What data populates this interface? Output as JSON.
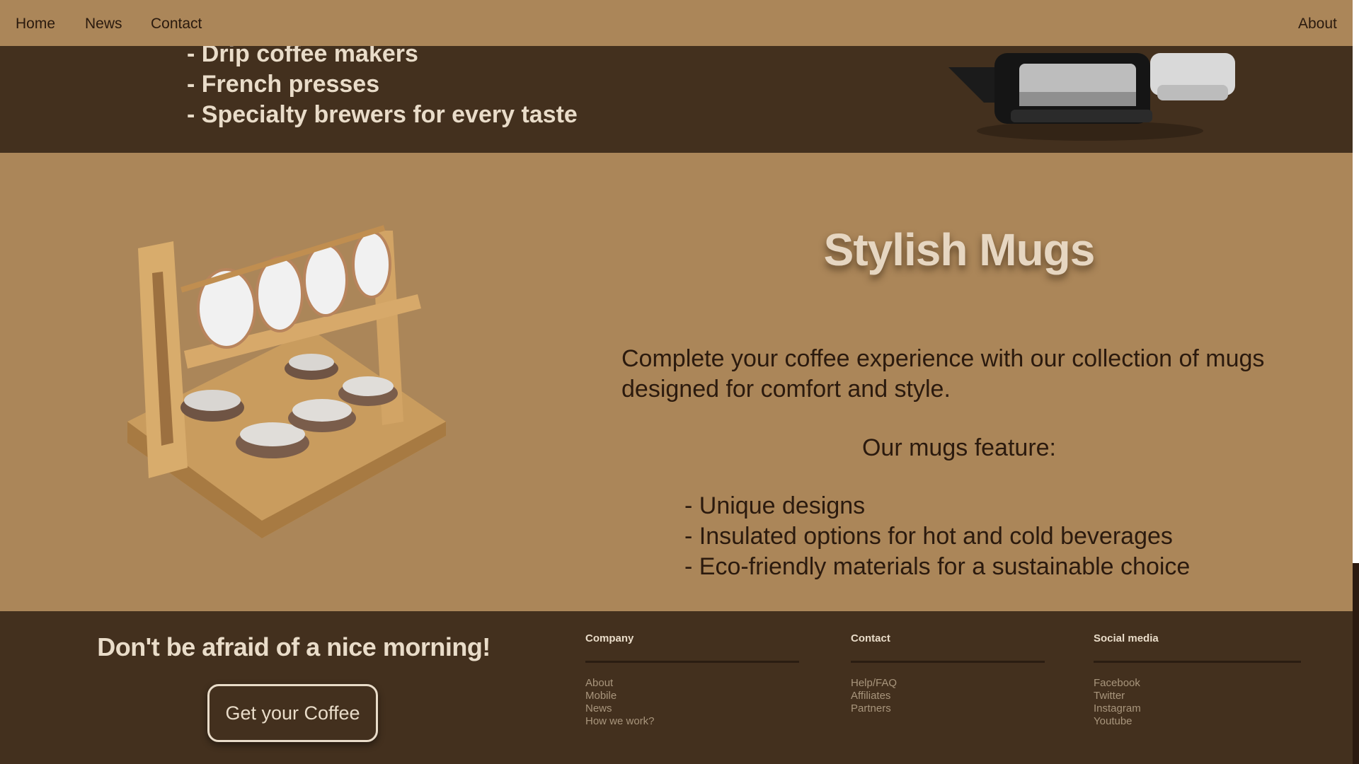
{
  "nav": {
    "home": "Home",
    "news": "News",
    "contact": "Contact",
    "about": "About"
  },
  "brewers": {
    "items": [
      "- Drip coffee makers",
      "- French presses",
      "- Specialty brewers for every taste"
    ]
  },
  "mugs": {
    "title": "Stylish Mugs",
    "description": "Complete your coffee experience with our collection of mugs designed for comfort and style.",
    "subtitle": "Our mugs feature:",
    "features": [
      "- Unique designs",
      "- Insulated options for hot and cold beverages",
      "- Eco-friendly materials for a sustainable choice"
    ]
  },
  "footer": {
    "slogan": "Don't be afraid of a nice morning!",
    "cta": "Get your Coffee",
    "company": {
      "heading": "Company",
      "links": [
        "About",
        "Mobile",
        "News",
        "How we work?"
      ]
    },
    "contact": {
      "heading": "Contact",
      "links": [
        "Help/FAQ",
        "Affiliates",
        "Partners"
      ]
    },
    "social": {
      "heading": "Social media",
      "links": [
        "Facebook",
        "Twitter",
        "Instagram",
        "Youtube"
      ]
    }
  },
  "colors": {
    "tan": "#ab8659",
    "dark_brown": "#43301e",
    "cream": "#e9dcc9",
    "text_dark": "#2b1a0e"
  }
}
